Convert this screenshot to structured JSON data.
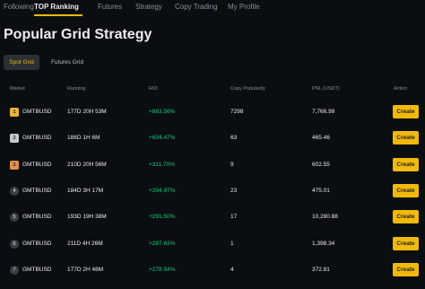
{
  "nav": {
    "tabs": [
      {
        "label": "Following"
      },
      {
        "label": "TOP Ranking"
      },
      {
        "label": "Futures"
      },
      {
        "label": "Strategy"
      },
      {
        "label": "Copy Trading"
      },
      {
        "label": "My Profile"
      }
    ],
    "active_tab": "TOP Ranking"
  },
  "page_title": "Popular Grid Strategy",
  "strategy_tabs": [
    {
      "label": "Spot Grid"
    },
    {
      "label": "Futures Grid"
    }
  ],
  "table": {
    "headers": {
      "market": "Market",
      "running": "Running",
      "roi": "ROI",
      "copy_popularity": "Copy Popularity",
      "pnl": "PNL (USDT)",
      "action": "Action"
    },
    "rows": [
      {
        "rank": "1",
        "market": "GMTBUSD",
        "running": "177D 20H 53M",
        "roi": "+883.56%",
        "copy_popularity": "7298",
        "pnl": "7,766.99",
        "action": "Create"
      },
      {
        "rank": "2",
        "market": "GMTBUSD",
        "running": "186D 1H 6M",
        "roi": "+634.47%",
        "copy_popularity": "63",
        "pnl": "465.46",
        "action": "Create"
      },
      {
        "rank": "3",
        "market": "GMTBUSD",
        "running": "210D 20H 56M",
        "roi": "+311.70%",
        "copy_popularity": "9",
        "pnl": "602.55",
        "action": "Create"
      },
      {
        "rank": "4",
        "market": "GMTBUSD",
        "running": "184D 3H 17M",
        "roi": "+294.97%",
        "copy_popularity": "23",
        "pnl": "475.01",
        "action": "Create"
      },
      {
        "rank": "5",
        "market": "GMTBUSD",
        "running": "193D 19H 38M",
        "roi": "+291.50%",
        "copy_popularity": "17",
        "pnl": "10,280.88",
        "action": "Create"
      },
      {
        "rank": "6",
        "market": "GMTBUSD",
        "running": "211D 4H 26M",
        "roi": "+287.63%",
        "copy_popularity": "1",
        "pnl": "1,398.34",
        "action": "Create"
      },
      {
        "rank": "7",
        "market": "GMTBUSD",
        "running": "177D 2H 48M",
        "roi": "+278.54%",
        "copy_popularity": "4",
        "pnl": "372.81",
        "action": "Create"
      }
    ]
  },
  "colors": {
    "accent": "#f0b90b",
    "positive": "#0ecb81",
    "background": "#0b0e11",
    "gold": "#e8b339",
    "silver": "#c5c9d0",
    "bronze": "#e08f4f"
  }
}
